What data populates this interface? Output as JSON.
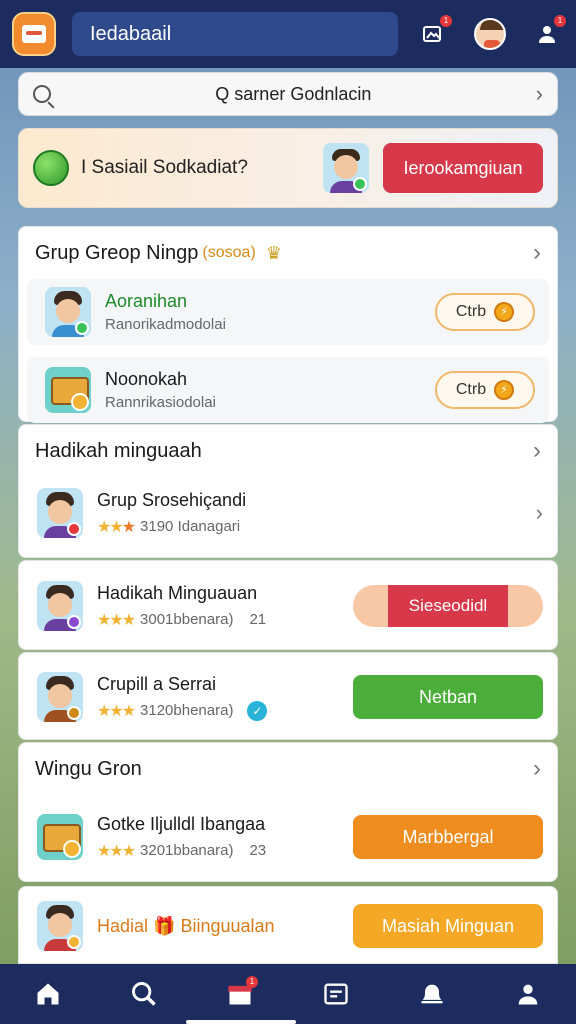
{
  "header": {
    "title": "Iedabaail",
    "notif_badge": "1",
    "bag_badge": "1",
    "icons": [
      "app-logo-icon",
      "photo-edit-icon",
      "profile-avatar-icon",
      "user-group-icon"
    ]
  },
  "search": {
    "query": "Q sarner Godnlacin"
  },
  "banner": {
    "text": "I Sasiail Sodkadiat?",
    "button_label": "Ierookamgiuan"
  },
  "group_card": {
    "title": "Grup Greop Ningp",
    "note": "(sosoa)",
    "items": [
      {
        "title": "Aoranihan",
        "subtitle": "Ranorikadmodolai",
        "action": "Ctrb"
      },
      {
        "title": "Noonokah",
        "subtitle": "Rannrikasiodolai",
        "action": "Ctrb"
      }
    ]
  },
  "weekly_card": {
    "title": "Hadikah minguaah",
    "item": {
      "title": "Grup Srosehiçandi",
      "count": "3190 Idanagari"
    }
  },
  "reward_rows": [
    {
      "title": "Hadikah Minguauan",
      "count": "3001bbenara)",
      "extra": "21",
      "button": "Sieseodidl"
    },
    {
      "title": "Crupill a Serrai",
      "count": "3120bhenara)",
      "button": "Netban"
    }
  ],
  "wingu_card": {
    "title": "Wingu Gron",
    "item": {
      "title": "Gotke Iljulldl Ibangaa",
      "count": "3201bbanara)",
      "extra": "23",
      "button": "Marbbergal"
    }
  },
  "last_row": {
    "title": "Hadial",
    "title_tail": "Biinguualan",
    "button": "Masiah Minguan"
  },
  "bottom_nav": {
    "icons": [
      "home-icon",
      "search-icon",
      "store-icon",
      "list-icon",
      "bell-icon",
      "profile-icon"
    ],
    "store_badge": "1"
  },
  "colors": {
    "nav_bg": "#1d2c5e",
    "title_pill": "#2f4a8c",
    "red": "#d8394a",
    "green": "#4cae3a",
    "orange": "#ef8c1e",
    "yellow": "#f5a726"
  }
}
